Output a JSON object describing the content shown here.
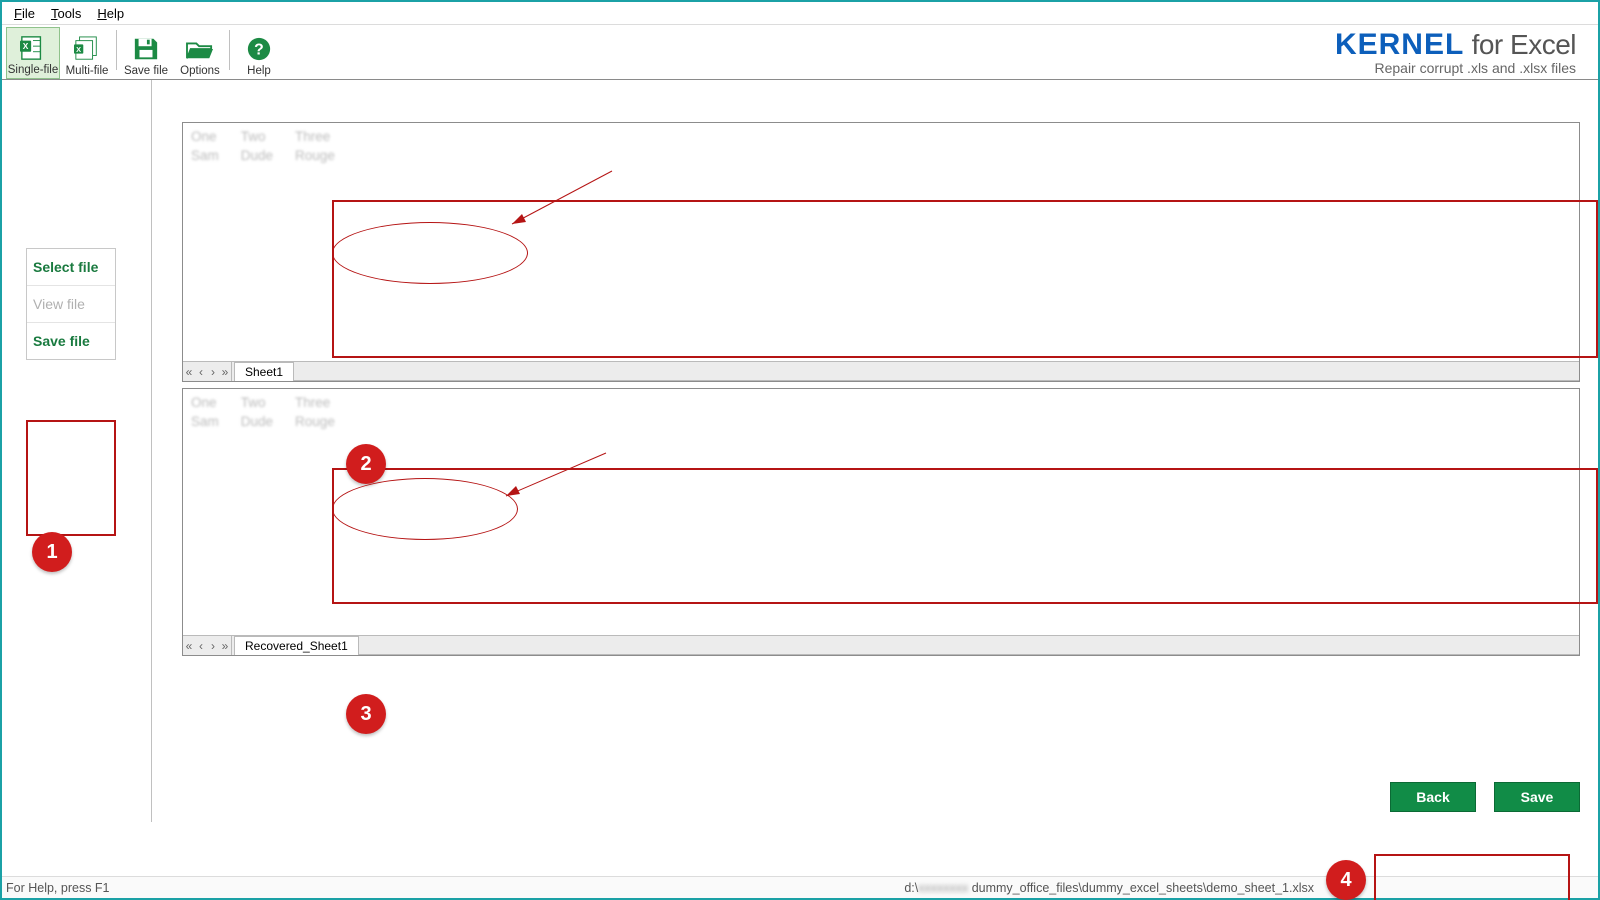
{
  "menu": {
    "file": "File",
    "tools": "Tools",
    "help": "Help"
  },
  "toolbar": {
    "single_file": "Single-file",
    "multi_file": "Multi-file",
    "save_file": "Save file",
    "options": "Options",
    "help": "Help"
  },
  "brand": {
    "kernel": "KERNEL",
    "for_excel": " for Excel",
    "sub": "Repair corrupt .xls and .xlsx files"
  },
  "sidebar": {
    "select_file": "Select file",
    "view_file": "View file",
    "save_file": "Save file"
  },
  "panes": {
    "top_tab": "Sheet1",
    "bottom_tab": "Recovered_Sheet1",
    "tab_nav_first": "«",
    "tab_nav_prev": "‹",
    "tab_nav_next": "›",
    "tab_nav_last": "»",
    "data": {
      "r1": [
        "One",
        "Two",
        "Three"
      ],
      "r2": [
        "Sam",
        "Dude",
        "Rouge"
      ]
    }
  },
  "buttons": {
    "back": "Back",
    "save": "Save"
  },
  "status": {
    "help": "For Help, press F1",
    "path_prefix": "d:\\",
    "path_blur": "xxxxxxxx",
    "path_suffix": " dummy_office_files\\dummy_excel_sheets\\demo_sheet_1.xlsx"
  },
  "callouts": {
    "c1": "1",
    "c2": "2",
    "c3": "3",
    "c4": "4"
  }
}
